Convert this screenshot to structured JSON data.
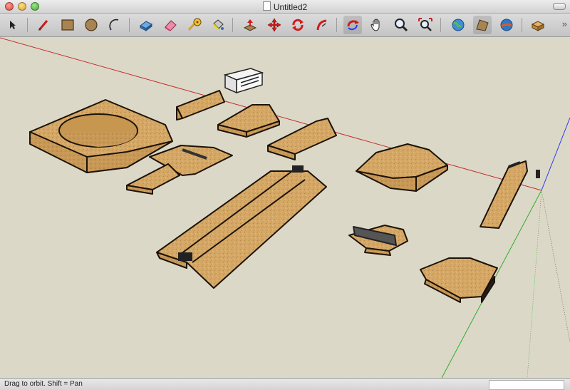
{
  "window": {
    "title": "Untitled2"
  },
  "toolbar": {
    "tools": [
      {
        "name": "select-tool"
      },
      {
        "name": "line-tool"
      },
      {
        "name": "rectangle-tool"
      },
      {
        "name": "circle-tool"
      },
      {
        "name": "arc-tool"
      },
      {
        "name": "make-component-tool"
      },
      {
        "name": "eraser-tool"
      },
      {
        "name": "tape-measure-tool"
      },
      {
        "name": "paint-bucket-tool"
      },
      {
        "name": "push-pull-tool"
      },
      {
        "name": "move-tool"
      },
      {
        "name": "rotate-tool"
      },
      {
        "name": "follow-me-tool"
      },
      {
        "name": "orbit-tool"
      },
      {
        "name": "pan-tool"
      },
      {
        "name": "zoom-tool"
      },
      {
        "name": "zoom-extents-tool"
      },
      {
        "name": "get-models-icon"
      },
      {
        "name": "share-model-icon"
      },
      {
        "name": "google-earth-icon"
      },
      {
        "name": "components-icon"
      }
    ],
    "more_label": "»"
  },
  "status": {
    "hint": "Drag to orbit.  Shift = Pan"
  },
  "colors": {
    "viewport_bg": "#dcd8c7",
    "cork": "#d4a766",
    "cork_dark": "#b88a4c",
    "red_axis": "#c23030",
    "green_axis": "#2fae2f",
    "blue_axis": "#2a3cf0"
  }
}
